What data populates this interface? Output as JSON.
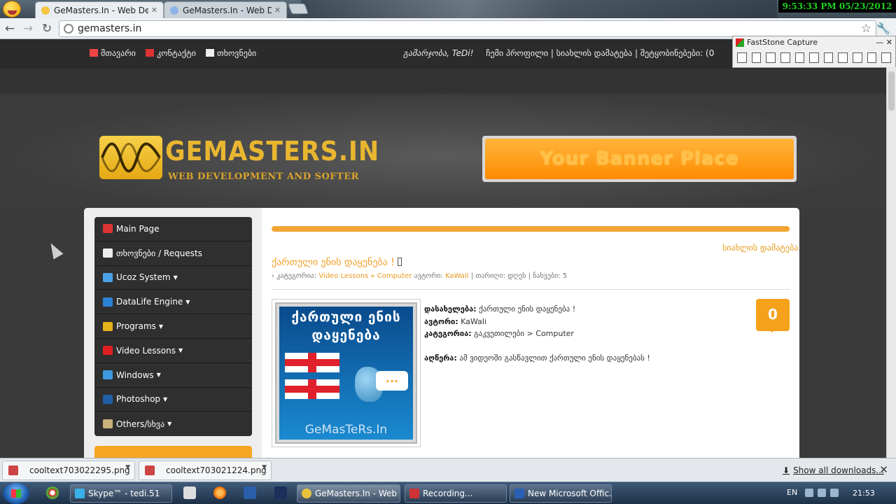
{
  "clock": "9:53:33 PM 05/23/2012",
  "browser": {
    "tabs": [
      {
        "title": "GeMasters.In - Web Develop",
        "active": true
      },
      {
        "title": "GeMasters.In - Web Develop",
        "active": false
      }
    ],
    "url": "gemasters.in"
  },
  "faststone": {
    "title": "FastStone Capture",
    "controls": "—  ✕"
  },
  "site_nav": {
    "links": [
      "მთავარი",
      "კონტაქტი",
      "თხოვნები"
    ],
    "greeting": "გამარჯობა, TeDi!",
    "user_links": "ჩემი პროფილი  |  სიახლის დამატება  |  შეტყობინებები: (0"
  },
  "logo": {
    "title": "GEMASTERS.IN",
    "subtitle": "WEB DEVELOPMENT AND SOFTER"
  },
  "banner": {
    "text": "Your Banner Place"
  },
  "sidebar_menu": [
    {
      "label": "Main Page",
      "dropdown": false,
      "color": "#d33"
    },
    {
      "label": "თხოვნები / Requests",
      "dropdown": false,
      "color": "#eee"
    },
    {
      "label": "Ucoz System",
      "dropdown": true,
      "color": "#4aa3e8"
    },
    {
      "label": "DataLife Engine",
      "dropdown": true,
      "color": "#2b83d6"
    },
    {
      "label": "Programs",
      "dropdown": true,
      "color": "#e4b21a"
    },
    {
      "label": "Video Lessons",
      "dropdown": true,
      "color": "#e02020"
    },
    {
      "label": "Windows",
      "dropdown": true,
      "color": "#3c9be0"
    },
    {
      "label": "Photoshop",
      "dropdown": true,
      "color": "#1f5fa8"
    },
    {
      "label": "Others/სხვა",
      "dropdown": true,
      "color": "#c9b27a"
    }
  ],
  "content": {
    "add_news": "სიახლის დამატება",
    "post_title": "ქართული ენის დაყენება !",
    "meta": {
      "category_label": "› კატეგორია:",
      "category": "Video Lessons » Computer",
      "author_label": "ავტორი:",
      "author": "KaWaIi",
      "date_label": "| თარიღი: დღეს | ნახვები: 5"
    },
    "thumb": {
      "line1": "ქართული ენის",
      "line2": "დაყენება",
      "bubble": "...",
      "brand": "GeMasTeRs.In"
    },
    "details": {
      "name_label": "დასახელება:",
      "name": "ქართული ენის დაყენება !",
      "author_label": "ავტორი:",
      "author": "KaWaIi",
      "category_label": "კატეგორია:",
      "category": "გაკვეთილები > Computer",
      "desc_label": "აღწერა:",
      "desc": "ამ ვიდეოში გასწავლით ქართული ენის დაყენებას !"
    },
    "comment_count": "0"
  },
  "downloads": {
    "items": [
      "cooltext703022295.png",
      "cooltext703021224.png"
    ],
    "show_all": "Show all downloads..."
  },
  "taskbar": {
    "tasks": [
      {
        "label": "Skype™ - tedi.51",
        "active": false,
        "color": "#3ab0e8"
      },
      {
        "label": "GeMasters.In - Web ...",
        "active": true,
        "color": "#e8c23a"
      },
      {
        "label": "Recording...",
        "active": false,
        "color": "#c33"
      },
      {
        "label": "New Microsoft Offic...",
        "active": false,
        "color": "#2b5fb4"
      }
    ],
    "lang": "EN",
    "time": "21:53"
  }
}
